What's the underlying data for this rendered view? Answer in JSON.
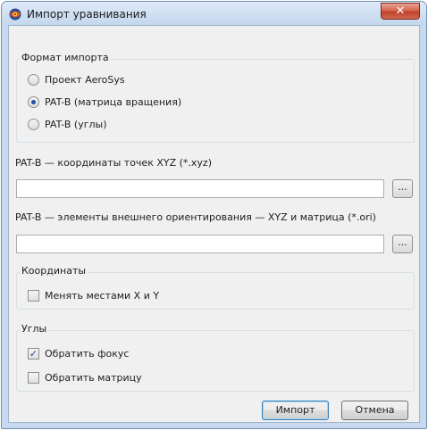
{
  "window": {
    "title": "Импорт уравнивания",
    "close_symbol": "✕"
  },
  "import_format": {
    "legend": "Формат импорта",
    "options": [
      {
        "label": "Проект AeroSys",
        "selected": false
      },
      {
        "label": "PAT-B (матрица вращения)",
        "selected": true
      },
      {
        "label": "PAT-B (углы)",
        "selected": false
      }
    ]
  },
  "xyz_file": {
    "label": "PAT-B — координаты точек XYZ (*.xyz)",
    "value": "",
    "browse_label": "..."
  },
  "ori_file": {
    "label": "PAT-B — элементы внешнего ориентирования — XYZ и матрица (*.ori)",
    "value": "",
    "browse_label": "..."
  },
  "coordinates": {
    "legend": "Координаты",
    "swap_xy": {
      "label": "Менять местами X и Y",
      "checked": false
    }
  },
  "angles": {
    "legend": "Углы",
    "invert_focus": {
      "label": "Обратить фокус",
      "checked": true
    },
    "invert_matrix": {
      "label": "Обратить матрицу",
      "checked": false
    }
  },
  "buttons": {
    "import": "Импорт",
    "cancel": "Отмена"
  },
  "icons": {
    "app": "eye-globe-icon",
    "check_mark": "✓"
  }
}
